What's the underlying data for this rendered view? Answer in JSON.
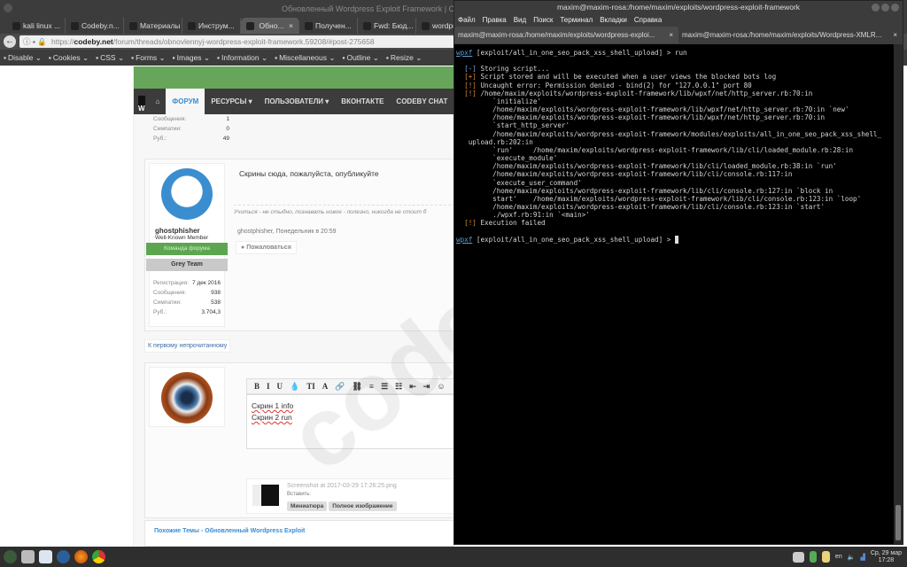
{
  "browser": {
    "window_title": "Обновленный Wordpress Exploit Framework | Codeby",
    "tabs": [
      {
        "label": "kali linux ..."
      },
      {
        "label": "Codeby.n..."
      },
      {
        "label": "Материалы ..."
      },
      {
        "label": "Инструм..."
      },
      {
        "label": "Обно...",
        "active": true
      },
      {
        "label": "Получен..."
      },
      {
        "label": "Fwd: Бюд..."
      },
      {
        "label": "wordpr..."
      }
    ],
    "url_prefix": "https://",
    "url_domain": "codeby.net",
    "url_path": "/forum/threads/obnovlennyj-wordpress-exploit-framework.59208/#post-275658",
    "toolbar": [
      "Disable",
      "Cookies",
      "CSS",
      "Forms",
      "Images",
      "Information",
      "Miscellaneous",
      "Outline",
      "Resize"
    ]
  },
  "forum": {
    "nav": {
      "logo": "W",
      "items": [
        "ФОРУМ",
        "РЕСУРСЫ ▾",
        "ПОЛЬЗОВАТЕЛИ ▾",
        "ВКОНТАКТЕ",
        "CODEBY CHAT"
      ]
    },
    "prev_stats": [
      {
        "k": "Сообщения:",
        "v": "1"
      },
      {
        "k": "Симпатии:",
        "v": "0"
      },
      {
        "k": "Руб.:",
        "v": "49"
      }
    ],
    "post": {
      "text": "Скрины сюда, пожалуйста, опубликуйте",
      "signature": "Учиться - не стыдно, познавать новое - полезно, никогда не стоит б",
      "meta": "ghostphisher, Понедельник в 20:59",
      "report": "Пожаловаться",
      "user": {
        "name": "ghostphisher",
        "rank": "Well-Known Member",
        "badge1": "Команда форума",
        "badge2": "Grey Team",
        "stats": [
          {
            "k": "Регистрация:",
            "v": "7 дек 2016"
          },
          {
            "k": "Сообщения:",
            "v": "938"
          },
          {
            "k": "Симпатии:",
            "v": "538"
          },
          {
            "k": "Руб.:",
            "v": "3.704,3"
          }
        ]
      }
    },
    "first_unread": "К первому непрочитанному",
    "editor": {
      "toolbar": [
        "B",
        "I",
        "U",
        "💧",
        "TI",
        "A",
        "🔗",
        "⛓",
        "≡",
        "☰",
        "☷",
        "⇤",
        "⇥",
        "☺"
      ],
      "line1": "Скрин 1 info",
      "line2": "Скрин 2 run"
    },
    "attachment": {
      "filename": "Screenshot at 2017-03-29 17:26:25.png",
      "insert_label": "Вставить:",
      "thumb_btn": "Миниатюра",
      "full_btn": "Полное изображение"
    },
    "similar": "Похожие Темы - Обновленный Wordpress Exploit",
    "watermark": "codeby.net"
  },
  "terminal": {
    "title": "maxim@maxim-rosa:/home/maxim/exploits/wordpress-exploit-framework",
    "menu": [
      "Файл",
      "Правка",
      "Вид",
      "Поиск",
      "Терминал",
      "Вкладки",
      "Справка"
    ],
    "tabs": [
      "maxim@maxim-rosa:/home/maxim/exploits/wordpress-exploi...",
      "maxim@maxim-rosa:/home/maxim/exploits/Wordpress-XMLR..."
    ],
    "prompt_name": "wpxf",
    "prompt_rest": " [exploit/all_in_one_seo_pack_xss_shell_upload] > ",
    "command": "run",
    "lines": [
      {
        "tag": "[-]",
        "cls": "b",
        "text": " Storing script..."
      },
      {
        "tag": "[+]",
        "cls": "o",
        "text": " Script stored and will be executed when a user views the blocked bots log"
      },
      {
        "tag": "[!]",
        "cls": "o",
        "text": " Uncaught error: Permission denied - bind(2) for \"127.0.0.1\" port 80"
      },
      {
        "tag": "[!]",
        "cls": "o",
        "text": " /home/maxim/exploits/wordpress-exploit-framework/lib/wpxf/net/http_server.rb:70:in"
      },
      {
        "tag": "",
        "text": "      `initialize'"
      },
      {
        "tag": "",
        "text": "      /home/maxim/exploits/wordpress-exploit-framework/lib/wpxf/net/http_server.rb:70:in `new'"
      },
      {
        "tag": "",
        "text": "      /home/maxim/exploits/wordpress-exploit-framework/lib/wpxf/net/http_server.rb:70:in"
      },
      {
        "tag": "",
        "text": "      `start_http_server'"
      },
      {
        "tag": "",
        "text": "      /home/maxim/exploits/wordpress-exploit-framework/modules/exploits/all_in_one_seo_pack_xss_shell_"
      },
      {
        "tag": "",
        "text": "upload.rb:202:in"
      },
      {
        "tag": "",
        "text": "      `run'     /home/maxim/exploits/wordpress-exploit-framework/lib/cli/loaded_module.rb:28:in"
      },
      {
        "tag": "",
        "text": "      `execute_module'"
      },
      {
        "tag": "",
        "text": "      /home/maxim/exploits/wordpress-exploit-framework/lib/cli/loaded_module.rb:38:in `run'"
      },
      {
        "tag": "",
        "text": "      /home/maxim/exploits/wordpress-exploit-framework/lib/cli/console.rb:117:in"
      },
      {
        "tag": "",
        "text": "      `execute_user_command'"
      },
      {
        "tag": "",
        "text": "      /home/maxim/exploits/wordpress-exploit-framework/lib/cli/console.rb:127:in `block in"
      },
      {
        "tag": "",
        "text": "      start'    /home/maxim/exploits/wordpress-exploit-framework/lib/cli/console.rb:123:in `loop'"
      },
      {
        "tag": "",
        "text": "      /home/maxim/exploits/wordpress-exploit-framework/lib/cli/console.rb:123:in `start'"
      },
      {
        "tag": "",
        "text": "      ./wpxf.rb:91:in `<main>'"
      },
      {
        "tag": "[!]",
        "cls": "o",
        "text": " Execution failed"
      }
    ]
  },
  "taskbar": {
    "lang": "en",
    "date": "Ср, 29 мар",
    "time": "17:28"
  }
}
